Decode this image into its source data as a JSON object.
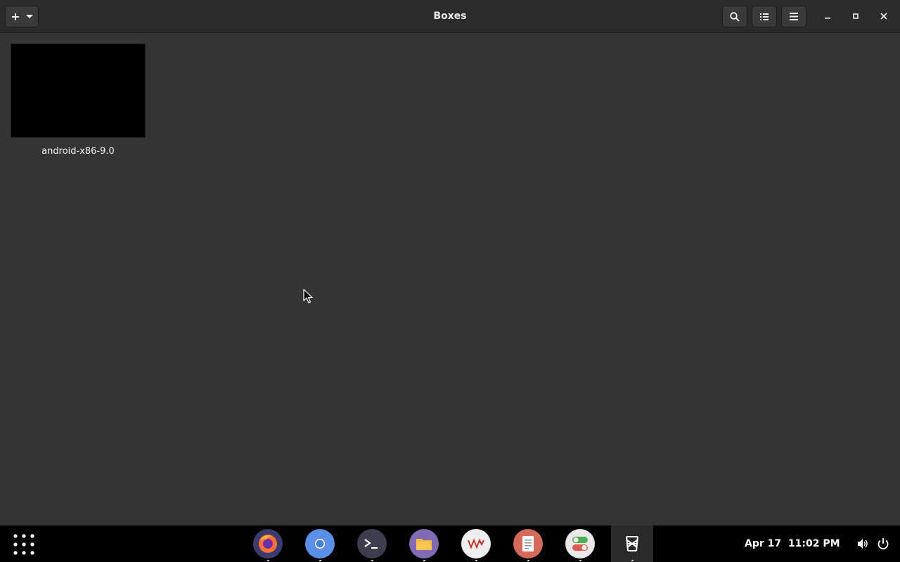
{
  "window": {
    "title": "Boxes",
    "colors": {
      "background": "#353535",
      "headerbar": "#2b2b2b",
      "dock": "#000000"
    }
  },
  "toolbar": {
    "new_button_icon": "plus-icon",
    "new_menu_icon": "chevron-down-icon",
    "search_icon": "search-icon",
    "view_toggle_icon": "list-view-icon",
    "menu_icon": "hamburger-menu-icon"
  },
  "window_controls": [
    "minimize-icon",
    "maximize-icon",
    "close-icon"
  ],
  "boxes": [
    {
      "name": "android-x86-9.0"
    }
  ],
  "dock": {
    "apps": [
      {
        "name": "Firefox",
        "icon": "firefox-icon",
        "color": "#3b3b6e"
      },
      {
        "name": "Chromium",
        "icon": "chromium-icon",
        "color": "#5b8ee6"
      },
      {
        "name": "Terminal",
        "icon": "terminal-icon",
        "color": "#3d3d4d"
      },
      {
        "name": "Files",
        "icon": "folder-icon",
        "color": "#7e6bb3"
      },
      {
        "name": "VM Manager",
        "icon": "vm-icon",
        "color": "#eeeeee"
      },
      {
        "name": "Text Editor",
        "icon": "document-icon",
        "color": "#d46a5a"
      },
      {
        "name": "Tweaks",
        "icon": "toggle-icon",
        "color": "#e8e8e8"
      },
      {
        "name": "Boxes",
        "icon": "boxes-icon",
        "color": "#2a2a2a"
      }
    ],
    "date": "Apr 17",
    "time": "11:02 PM"
  }
}
